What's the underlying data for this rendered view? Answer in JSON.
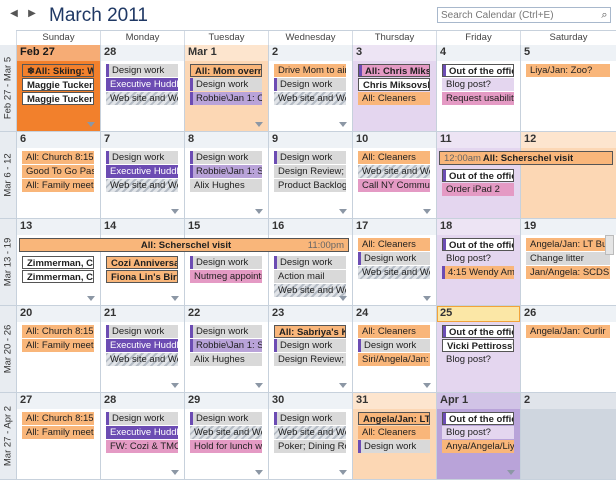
{
  "header": {
    "title": "March 2011",
    "search_placeholder": "Search Calendar (Ctrl+E)",
    "prev_glyph": "◀",
    "next_glyph": "▶",
    "search_button_glyph": "⌕"
  },
  "weekdays": [
    "Sunday",
    "Monday",
    "Tuesday",
    "Wednesday",
    "Thursday",
    "Friday",
    "Saturday"
  ],
  "colors": {
    "orange": "#f9b67a",
    "orange_dark": "#f2802c",
    "peach": "#fcd7b4",
    "purple": "#6c4cb3",
    "purple_light": "#b9a3d9",
    "pink": "#e49ac4",
    "lavender": "#e4d6ef",
    "gray": "#d9d9d9",
    "grayblue": "#cfd6df",
    "white": "#ffffff",
    "today_border": "#f2a33a"
  },
  "weeks": [
    {
      "label": "Feb 27 - Mar 5",
      "days": [
        {
          "num": "Feb 27",
          "bg": "orange_dark",
          "more": true,
          "events": [
            {
              "text": "All: Skiing: Whi",
              "color": "orange_dark",
              "bold": true,
              "bordered": true,
              "glyph": "❄"
            },
            {
              "text": "Maggie Tucker's",
              "color": "white",
              "bold": true,
              "bordered": true
            },
            {
              "text": "Maggie Tucker's",
              "color": "white",
              "bold": true,
              "bordered": true
            }
          ]
        },
        {
          "num": "28",
          "bg": "white",
          "more": false,
          "events": [
            {
              "text": "Design work",
              "color": "gray",
              "stripe": "purple"
            },
            {
              "text": "Executive Huddle:",
              "color": "purple",
              "textColor": "#ffffff"
            },
            {
              "text": "Web site and We",
              "color": "gray",
              "hatch": true
            }
          ]
        },
        {
          "num": "Mar 1",
          "bg": "peach",
          "more": true,
          "events": [
            {
              "text": "All: Mom overni",
              "color": "orange",
              "bold": true,
              "bordered": true
            },
            {
              "text": "Design work",
              "color": "gray",
              "stripe": "purple"
            },
            {
              "text": "Robbie\\Jan 1: C",
              "color": "purple_light",
              "stripe": "purple"
            }
          ]
        },
        {
          "num": "2",
          "bg": "white",
          "more": true,
          "events": [
            {
              "text": "Drive Mom to air",
              "color": "orange"
            },
            {
              "text": "Design work",
              "color": "gray",
              "stripe": "purple"
            },
            {
              "text": "Web site and We",
              "color": "gray",
              "hatch": true
            }
          ]
        },
        {
          "num": "3",
          "bg": "lavender",
          "more": false,
          "events": [
            {
              "text": "All: Chris Miksov",
              "color": "pink",
              "bold": true,
              "bordered": true,
              "stripe": "purple"
            },
            {
              "text": "Chris Miksovsky",
              "color": "white",
              "bold": true,
              "bordered": true
            },
            {
              "text": "All: Cleaners",
              "color": "orange"
            }
          ]
        },
        {
          "num": "4",
          "bg": "white",
          "more": false,
          "events": [
            {
              "text": "Out of the offic",
              "color": "white",
              "bold": true,
              "bordered": true,
              "stripe": "purple"
            },
            {
              "text": "Blog post?",
              "color": "lavender"
            },
            {
              "text": "Request usability",
              "color": "pink"
            }
          ]
        },
        {
          "num": "5",
          "bg": "white",
          "more": false,
          "events": [
            {
              "text": "Liya/Jan: Zoo?",
              "color": "orange"
            }
          ]
        }
      ]
    },
    {
      "label": "Mar 6 - 12",
      "days": [
        {
          "num": "6",
          "bg": "white",
          "more": false,
          "events": [
            {
              "text": "All: Church 8:15",
              "color": "orange"
            },
            {
              "text": "Good To Go Pass",
              "color": "orange"
            },
            {
              "text": "All: Family meetin",
              "color": "orange"
            }
          ]
        },
        {
          "num": "7",
          "bg": "white",
          "more": true,
          "events": [
            {
              "text": "Design work",
              "color": "gray",
              "stripe": "purple"
            },
            {
              "text": "Executive Huddle:",
              "color": "purple",
              "textColor": "#ffffff"
            },
            {
              "text": "Web site and We",
              "color": "gray",
              "hatch": true
            }
          ]
        },
        {
          "num": "8",
          "bg": "white",
          "more": true,
          "events": [
            {
              "text": "Design work",
              "color": "gray",
              "stripe": "purple"
            },
            {
              "text": "Robbie\\Jan 1: S",
              "color": "purple_light",
              "stripe": "purple"
            },
            {
              "text": "Alix Hughes",
              "color": "gray"
            }
          ]
        },
        {
          "num": "9",
          "bg": "white",
          "more": true,
          "events": [
            {
              "text": "Design work",
              "color": "gray",
              "stripe": "purple"
            },
            {
              "text": "Design Review; Fa",
              "color": "gray"
            },
            {
              "text": "Product Backlog I",
              "color": "gray"
            }
          ]
        },
        {
          "num": "10",
          "bg": "white",
          "more": true,
          "events": [
            {
              "text": "All: Cleaners",
              "color": "orange"
            },
            {
              "text": "Web site and We",
              "color": "gray",
              "hatch": true
            },
            {
              "text": "Call NY Communi",
              "color": "pink"
            }
          ]
        },
        {
          "num": "11",
          "bg": "lavender",
          "more": false,
          "events": [
            {
              "text": "Out of the offic",
              "color": "white",
              "bold": true,
              "bordered": true,
              "stripe": "purple"
            },
            {
              "text": "Order iPad 2",
              "color": "pink"
            }
          ]
        },
        {
          "num": "12",
          "bg": "peach",
          "more": false,
          "events": []
        }
      ],
      "span": {
        "text": "All: Scherschel visit",
        "time": "12:00am",
        "start": 5,
        "end": 6,
        "timeSide": "left"
      }
    },
    {
      "label": "Mar 13 - 19",
      "days": [
        {
          "num": "13",
          "bg": "white",
          "more": true,
          "events": [
            {
              "text": "Zimmerman, Ch",
              "color": "white",
              "bold": true,
              "bordered": true
            },
            {
              "text": "Zimmerman, Ch",
              "color": "white",
              "bold": true,
              "bordered": true
            }
          ]
        },
        {
          "num": "14",
          "bg": "white",
          "more": true,
          "events": [
            {
              "text": "Cozi Anniversary",
              "color": "orange",
              "bold": true,
              "bordered": true
            },
            {
              "text": "Fiona Lin's Birth",
              "color": "orange",
              "bold": true,
              "bordered": true
            }
          ]
        },
        {
          "num": "15",
          "bg": "white",
          "more": false,
          "events": [
            {
              "text": "Design work",
              "color": "gray",
              "stripe": "purple"
            },
            {
              "text": "Nutmeg appointr",
              "color": "pink"
            }
          ]
        },
        {
          "num": "16",
          "bg": "white",
          "more": true,
          "events": [
            {
              "text": "Design work",
              "color": "gray",
              "stripe": "purple"
            },
            {
              "text": "Action mail",
              "color": "gray"
            },
            {
              "text": "Web site and We",
              "color": "gray",
              "hatch": true
            }
          ]
        },
        {
          "num": "17",
          "bg": "white",
          "more": true,
          "events": [
            {
              "text": "All: Cleaners",
              "color": "orange"
            },
            {
              "text": "Design work",
              "color": "gray",
              "stripe": "purple"
            },
            {
              "text": "Web site and We",
              "color": "gray",
              "hatch": true
            }
          ]
        },
        {
          "num": "18",
          "bg": "lavender",
          "more": false,
          "events": [
            {
              "text": "Out of the offic",
              "color": "white",
              "bold": true,
              "bordered": true,
              "stripe": "purple"
            },
            {
              "text": "Blog post?",
              "color": "lavender"
            },
            {
              "text": "4:15 Wendy Amdi",
              "color": "orange",
              "stripe": "purple"
            }
          ]
        },
        {
          "num": "19",
          "bg": "white",
          "more": false,
          "events": [
            {
              "text": "Angela/Jan: LT Bu",
              "color": "orange"
            },
            {
              "text": "Change litter",
              "color": "gray"
            },
            {
              "text": "Jan/Angela: SCDS",
              "color": "orange"
            }
          ]
        }
      ],
      "span": {
        "text": "All: Scherschel visit",
        "time": "11:00pm",
        "start": 0,
        "end": 3,
        "timeSide": "right"
      }
    },
    {
      "label": "Mar 20 - 26",
      "days": [
        {
          "num": "20",
          "bg": "white",
          "more": false,
          "events": [
            {
              "text": "All: Church 8:15",
              "color": "orange"
            },
            {
              "text": "All: Family meetin",
              "color": "orange"
            }
          ]
        },
        {
          "num": "21",
          "bg": "white",
          "more": true,
          "events": [
            {
              "text": "Design work",
              "color": "gray",
              "stripe": "purple"
            },
            {
              "text": "Executive Huddle:",
              "color": "purple",
              "textColor": "#ffffff"
            },
            {
              "text": "Web site and We",
              "color": "gray",
              "hatch": true
            }
          ]
        },
        {
          "num": "22",
          "bg": "white",
          "more": true,
          "events": [
            {
              "text": "Design work",
              "color": "gray",
              "stripe": "purple"
            },
            {
              "text": "Robbie\\Jan 1: S",
              "color": "purple_light",
              "stripe": "purple"
            },
            {
              "text": "Alix Hughes",
              "color": "gray"
            }
          ]
        },
        {
          "num": "23",
          "bg": "white",
          "more": true,
          "events": [
            {
              "text": "All: Sabriya's Kic",
              "color": "orange",
              "bold": true,
              "bordered": true
            },
            {
              "text": "Design work",
              "color": "gray",
              "stripe": "purple"
            },
            {
              "text": "Design Review; Fa",
              "color": "gray"
            }
          ]
        },
        {
          "num": "24",
          "bg": "white",
          "more": true,
          "events": [
            {
              "text": "All: Cleaners",
              "color": "orange"
            },
            {
              "text": "Design work",
              "color": "gray",
              "stripe": "purple"
            },
            {
              "text": "Siri/Angela/Jan: L",
              "color": "orange"
            }
          ]
        },
        {
          "num": "25",
          "bg": "lavender",
          "today": true,
          "more": false,
          "events": [
            {
              "text": "Out of the offic",
              "color": "white",
              "bold": true,
              "bordered": true,
              "stripe": "purple"
            },
            {
              "text": "Vicki Pettiross's",
              "color": "white",
              "bold": true,
              "bordered": true
            },
            {
              "text": "Blog post?",
              "color": "lavender"
            }
          ]
        },
        {
          "num": "26",
          "bg": "white",
          "more": false,
          "events": [
            {
              "text": "Angela/Jan: Curlir",
              "color": "orange"
            }
          ]
        }
      ]
    },
    {
      "label": "Mar 27 - Apr 2",
      "days": [
        {
          "num": "27",
          "bg": "white",
          "more": false,
          "events": [
            {
              "text": "All: Church 8:15",
              "color": "orange"
            },
            {
              "text": "All: Family meetin",
              "color": "orange"
            }
          ]
        },
        {
          "num": "28",
          "bg": "white",
          "more": true,
          "events": [
            {
              "text": "Design work",
              "color": "gray",
              "stripe": "purple"
            },
            {
              "text": "Executive Huddle:",
              "color": "purple",
              "textColor": "#ffffff"
            },
            {
              "text": "FW: Cozi & TMO",
              "color": "pink"
            }
          ]
        },
        {
          "num": "29",
          "bg": "white",
          "more": true,
          "events": [
            {
              "text": "Design work",
              "color": "gray",
              "stripe": "purple"
            },
            {
              "text": "Web site and We",
              "color": "gray",
              "hatch": true
            },
            {
              "text": "Hold for lunch wi",
              "color": "pink"
            }
          ]
        },
        {
          "num": "30",
          "bg": "white",
          "more": true,
          "events": [
            {
              "text": "Design work",
              "color": "gray",
              "stripe": "purple"
            },
            {
              "text": "Web site and We",
              "color": "gray",
              "hatch": true
            },
            {
              "text": "Poker; Dining Roc",
              "color": "gray"
            }
          ]
        },
        {
          "num": "31",
          "bg": "peach",
          "more": false,
          "events": [
            {
              "text": "Angela/Jan: LT C",
              "color": "orange",
              "bold": true,
              "bordered": true
            },
            {
              "text": "All: Cleaners",
              "color": "orange"
            },
            {
              "text": "Design work",
              "color": "gray",
              "stripe": "purple"
            }
          ]
        },
        {
          "num": "Apr 1",
          "bg": "purple_light",
          "more": true,
          "events": [
            {
              "text": "Out of the offic",
              "color": "white",
              "bold": true,
              "bordered": true,
              "stripe": "purple"
            },
            {
              "text": "Blog post?",
              "color": "lavender"
            },
            {
              "text": "Anya/Angela/Liya",
              "color": "orange"
            }
          ]
        },
        {
          "num": "2",
          "bg": "grayblue",
          "more": false,
          "events": []
        }
      ]
    }
  ]
}
